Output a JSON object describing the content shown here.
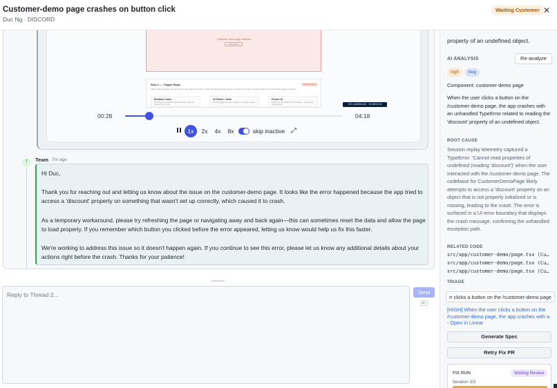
{
  "header": {
    "title": "Customer-demo page crashes on button click",
    "subtitle": "Duc Ng · DISCORD",
    "status": "Waiting Customer",
    "close_glyph": "✕",
    "status_color": "#a4570f"
  },
  "replay": {
    "frame_text": "Customer-demo page rendered",
    "frame_button": "Retry Now",
    "step_title": "Step 1 — Trigger Bugs",
    "step_tag": "Checkout Flow",
    "step_desc": "These buttons trigger intentional UI bugs. After interacting, check the admin replay viewer to watch the replay and see exactly how these bugs appear to users.",
    "cols": [
      {
        "title": "Runtime Crash",
        "desc": "Simulates an unhandled TypeError that breaks the discount flow render."
      },
      {
        "title": "UI Flicker / Jank",
        "desc": "Rapidly toggles layout and triggers a visible re-render."
      },
      {
        "title": "Frozen UI",
        "desc": "Blocks the main thread for 3 seconds — UI becomes unresponsive."
      }
    ],
    "chip": "SID: a3b9f8c4d2... 00:28/04:18",
    "time_current": "00:28",
    "time_total": "04:18",
    "progress": 0.11,
    "play_icon": "pause-icon",
    "speeds": [
      "1x",
      "2x",
      "4x",
      "8x"
    ],
    "active_speed": "1x",
    "skip_label": "skip inactive",
    "skip_enabled": true,
    "fullscreen_glyph": "⤢"
  },
  "message": {
    "avatar": "T",
    "author": "Team",
    "time": "7m ago",
    "paragraphs": [
      "Hi Duc,",
      "Thank you for reaching out and letting us know about the issue on the customer-demo page. It looks like the error happened because the app tried to access a 'discount' property on something that wasn't set up correctly, which caused it to crash.",
      "As a temporary workaround, please try refreshing the page or navigating away and back again—this can sometimes reset the data and allow the page to load properly. If you remember which button you clicked before the error appeared, letting us know would help us fix this faster.",
      "We're working to address this issue so it doesn't happen again. If you continue to see this error, please let us know any additional details about your actions right before the crash. Thanks for your patience!"
    ]
  },
  "reply": {
    "placeholder": "Reply to Thread 2...",
    "send_label": "Send",
    "kbd_hint": "⌘↵"
  },
  "analysis": {
    "top_text": "property of an undefined object.",
    "section_title": "AI ANALYSIS",
    "reanalyze_label": "Re-analyze",
    "tags": [
      "high",
      "bug"
    ],
    "component_label": "Component:",
    "component_value": "customer-demo page",
    "summary": "When the user clicks a button on the /customer-demo page, the app crashes with an unhandled TypeError related to reading the 'discount' property of an undefined object.",
    "root_cause_title": "ROOT CAUSE",
    "root_cause": "Session replay telemetry captured a TypeError: 'Cannot read properties of undefined (reading 'discount')' when the user interacted with the /customer-demo page. The codebase for CustomerDemoPage likely attempts to access a 'discount' property on an object that is not properly initialized or is missing, leading to the crash. The error is surfaced in a UI error boundary that displays the crash message, confirming the unhandled exception path.",
    "related_code_title": "RELATED CODE",
    "related_code": [
      "src/app/customer-demo/page.tsx (Cu…",
      "src/app/customer-demo/page.tsx (Cu…",
      "src/app/customer-demo/page.tsx (Cu…"
    ],
    "triage_title": "TRIAGE",
    "triage_value": "When the user clicks a button on the /customer-demo page",
    "linear_link": "[HIGH] When the user clicks a button on the /customer-demo page, the app crashes with a - Open in Linear",
    "generate_spec_label": "Generate Spec",
    "retry_fix_label": "Retry Fix PR",
    "fix_run": {
      "label": "FIX RUN",
      "status": "Waiting Review",
      "iteration": "Iteration 3/3",
      "progress": 1.0
    }
  }
}
